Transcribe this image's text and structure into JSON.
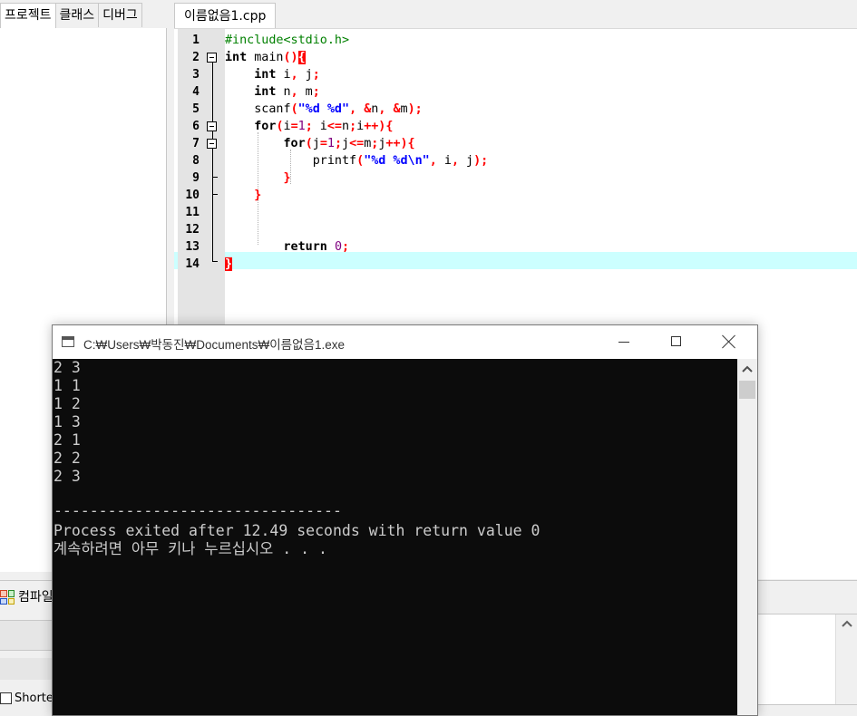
{
  "left_panel": {
    "tabs": [
      "프로젝트",
      "클래스",
      "디버그"
    ]
  },
  "editor": {
    "tab_label": "이름없음1.cpp",
    "highlight_line": 14,
    "line_numbers": [
      "1",
      "2",
      "3",
      "4",
      "5",
      "6",
      "7",
      "8",
      "9",
      "10",
      "11",
      "12",
      "13",
      "14"
    ],
    "lines": [
      "#include<stdio.h>",
      "int main(){",
      "    int i, j;",
      "    int n, m;",
      "    scanf(\"%d %d\", &n, &m);",
      "    for(i=1; i<=n;i++){",
      "        for(j=1;j<=m;j++){",
      "            printf(\"%d %d\\n\", i, j);",
      "        }",
      "    }",
      "",
      "",
      "        return 0;",
      "}"
    ]
  },
  "bottom_panel": {
    "compile_tab_label": "컴파일",
    "shortcut_checkbox_label": "Shorte"
  },
  "console": {
    "title": "C:₩Users₩박동진₩Documents₩이름없음1.exe",
    "buttons": {
      "minimize": "minimize",
      "maximize": "maximize",
      "close": "close"
    },
    "output_lines": [
      "2 3",
      "1 1",
      "1 2",
      "1 3",
      "2 1",
      "2 2",
      "2 3",
      "",
      "--------------------------------",
      "Process exited after 12.49 seconds with return value 0",
      "계속하려면 아무 키나 누르십시오 . . ."
    ]
  }
}
